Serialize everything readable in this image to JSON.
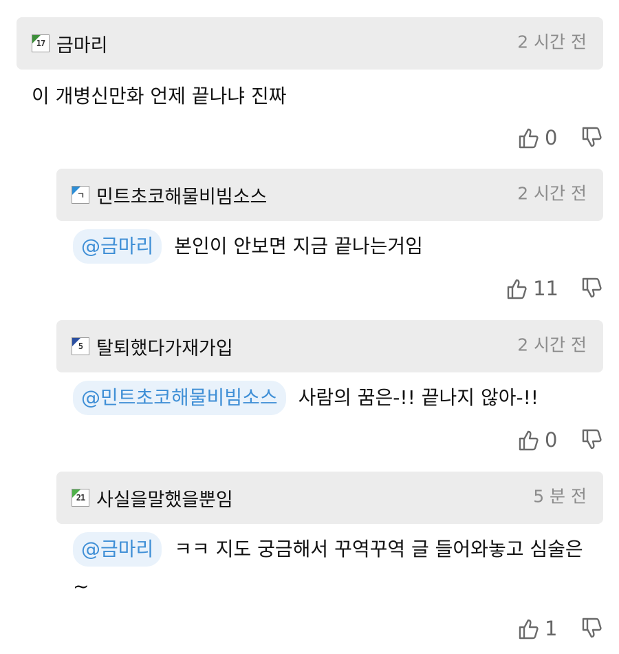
{
  "comments": [
    {
      "badge": "17",
      "badge_color": "#3d8f3a",
      "nick": "금마리",
      "time": "2 시간 전",
      "mention": "",
      "text": "이 개병신만화 언제 끝나냐 진짜",
      "up_count": "0"
    },
    {
      "badge": "ㄱ",
      "badge_color": "#2d8ed6",
      "nick": "민트초코해물비빔소스",
      "time": "2 시간 전",
      "mention": "@금마리",
      "text": "본인이 안보면 지금 끝나는거임",
      "up_count": "11"
    },
    {
      "badge": "5",
      "badge_color": "#2b4fa0",
      "nick": "탈퇴했다가재가입",
      "time": "2 시간 전",
      "mention": "@민트초코해물비빔소스",
      "text": "사람의 꿈은-!! 끝나지 않아-!!",
      "up_count": "0"
    },
    {
      "badge": "21",
      "badge_color": "#4fb04a",
      "nick": "사실을말했을뿐임",
      "time": "5 분 전",
      "mention": "@금마리",
      "text": "ㅋㅋ 지도 궁금해서 꾸역꾸역 글 들어와놓고 심술은~",
      "up_count": "1"
    }
  ],
  "icons": {
    "upvote": "thumbs-up-icon",
    "downvote": "thumbs-down-icon"
  }
}
